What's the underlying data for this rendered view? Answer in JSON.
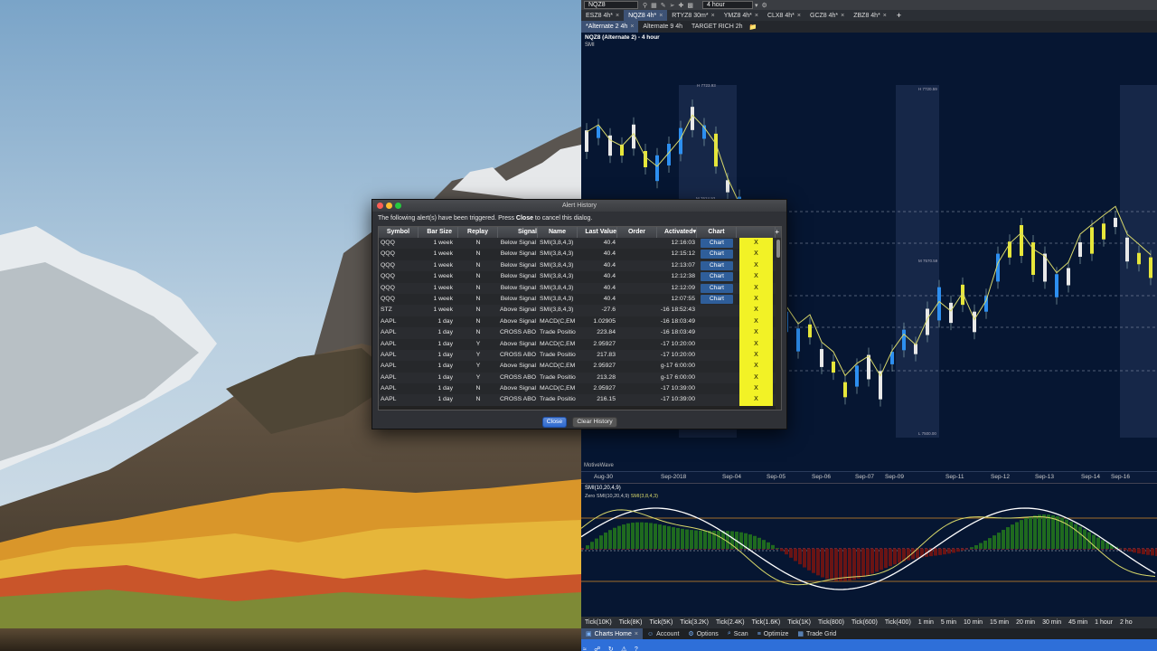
{
  "platform": {
    "symbol_input": "NQZ8",
    "timeframe": "4 hour",
    "symbol_tabs": [
      {
        "label": "ESZ8 4h*"
      },
      {
        "label": "NQZ8 4h*",
        "active": true
      },
      {
        "label": "RTYZ8 30m*"
      },
      {
        "label": "YMZ8 4h*"
      },
      {
        "label": "CLX8 4h*"
      },
      {
        "label": "GCZ8 4h*"
      },
      {
        "label": "ZBZ8 4h*"
      }
    ],
    "workspace_tabs": [
      {
        "label": "*Alternate 2 4h",
        "active": true
      },
      {
        "label": "Alternate 9 4h"
      },
      {
        "label": "TARGET RICH  2h"
      }
    ],
    "chart": {
      "title": "NQZ8 (Alternate 2) - 4 hour",
      "indicator": "SMI",
      "watermark": "MotiveWave",
      "x_labels": [
        "Aug-30",
        "Sep-2018",
        "Sep-04",
        "Sep-05",
        "Sep-06",
        "Sep-07",
        "Sep-09",
        "Sep-11",
        "Sep-12",
        "Sep-13",
        "Sep-14",
        "Sep-16"
      ],
      "level_labels": [
        "H 7723.93",
        "H 7720.59",
        "M 7624.93",
        "M 7570.59",
        "L 7500.00"
      ]
    },
    "smi": {
      "title": "SMI(10,20,4,9)",
      "legend_prefix": "Zero  SMI(10,20,4,9)",
      "legend_series": "SMI(3,8,4,3)"
    },
    "bar_sizes": [
      "Tick(10K)",
      "Tick(8K)",
      "Tick(5K)",
      "Tick(3.2K)",
      "Tick(2.4K)",
      "Tick(1.6K)",
      "Tick(1K)",
      "Tick(800)",
      "Tick(600)",
      "Tick(400)",
      "1 min",
      "5 min",
      "10 min",
      "15 min",
      "20 min",
      "30 min",
      "45 min",
      "1 hour",
      "2 ho"
    ],
    "bottom_tabs": [
      {
        "label": "Charts Home",
        "active": true
      },
      {
        "label": "Account"
      },
      {
        "label": "Options"
      },
      {
        "label": "Scan"
      },
      {
        "label": "Optimize"
      },
      {
        "label": "Trade Grid"
      }
    ],
    "colors": {
      "background": "#061632",
      "bull_candle": "#2d8ff0",
      "bear_candle": "#e8e8e8",
      "yellow_candle": "#e6e63a",
      "ma_line": "#d8d86a",
      "status_bar": "#2e6fd9"
    }
  },
  "dialog": {
    "title": "Alert History",
    "message_pre": "The following alert(s) have been triggered.  Press ",
    "message_bold": "Close",
    "message_post": " to cancel this dialog.",
    "columns": [
      "Symbol",
      "Bar Size",
      "Replay",
      "Signal",
      "Name",
      "Last Value",
      "Order",
      "Activated▾",
      "Chart",
      ""
    ],
    "rows": [
      {
        "symbol": "QQQ",
        "bar_size": "1 week",
        "replay": "N",
        "signal": "Below Signal",
        "name": "SMI(3,8,4,3)",
        "last": "40.4",
        "order": "",
        "activated": "12:16:03",
        "chart": "Chart",
        "x": "X"
      },
      {
        "symbol": "QQQ",
        "bar_size": "1 week",
        "replay": "N",
        "signal": "Below Signal",
        "name": "SMI(3,8,4,3)",
        "last": "40.4",
        "order": "",
        "activated": "12:15:12",
        "chart": "Chart",
        "x": "X"
      },
      {
        "symbol": "QQQ",
        "bar_size": "1 week",
        "replay": "N",
        "signal": "Below Signal",
        "name": "SMI(3,8,4,3)",
        "last": "40.4",
        "order": "",
        "activated": "12:13:07",
        "chart": "Chart",
        "x": "X"
      },
      {
        "symbol": "QQQ",
        "bar_size": "1 week",
        "replay": "N",
        "signal": "Below Signal",
        "name": "SMI(3,8,4,3)",
        "last": "40.4",
        "order": "",
        "activated": "12:12:38",
        "chart": "Chart",
        "x": "X"
      },
      {
        "symbol": "QQQ",
        "bar_size": "1 week",
        "replay": "N",
        "signal": "Below Signal",
        "name": "SMI(3,8,4,3)",
        "last": "40.4",
        "order": "",
        "activated": "12:12:09",
        "chart": "Chart",
        "x": "X"
      },
      {
        "symbol": "QQQ",
        "bar_size": "1 week",
        "replay": "N",
        "signal": "Below Signal",
        "name": "SMI(3,8,4,3)",
        "last": "40.4",
        "order": "",
        "activated": "12:07:55",
        "chart": "Chart",
        "x": "X"
      },
      {
        "symbol": "STZ",
        "bar_size": "1 week",
        "replay": "N",
        "signal": "Above Signal",
        "name": "SMI(3,8,4,3)",
        "last": "-27.6",
        "order": "",
        "activated": "-16 18:52:43",
        "chart": "",
        "x": "X"
      },
      {
        "symbol": "AAPL",
        "bar_size": "1 day",
        "replay": "N",
        "signal": "Above Signal",
        "name": "MACD(C,EM",
        "last": "1.02905",
        "order": "",
        "activated": "-16 18:03:49",
        "chart": "",
        "x": "X"
      },
      {
        "symbol": "AAPL",
        "bar_size": "1 day",
        "replay": "N",
        "signal": "CROSS ABO",
        "name": "Trade Positio",
        "last": "223.84",
        "order": "",
        "activated": "-16 18:03:49",
        "chart": "",
        "x": "X"
      },
      {
        "symbol": "AAPL",
        "bar_size": "1 day",
        "replay": "Y",
        "signal": "Above Signal",
        "name": "MACD(C,EM",
        "last": "2.95927",
        "order": "",
        "activated": "-17 10:20:00",
        "chart": "",
        "x": "X"
      },
      {
        "symbol": "AAPL",
        "bar_size": "1 day",
        "replay": "Y",
        "signal": "CROSS ABO",
        "name": "Trade Positio",
        "last": "217.83",
        "order": "",
        "activated": "-17 10:20:00",
        "chart": "",
        "x": "X"
      },
      {
        "symbol": "AAPL",
        "bar_size": "1 day",
        "replay": "Y",
        "signal": "Above Signal",
        "name": "MACD(C,EM",
        "last": "2.95927",
        "order": "",
        "activated": "g-17 6:00:00",
        "chart": "",
        "x": "X"
      },
      {
        "symbol": "AAPL",
        "bar_size": "1 day",
        "replay": "Y",
        "signal": "CROSS ABO",
        "name": "Trade Positio",
        "last": "213.28",
        "order": "",
        "activated": "g-17 6:00:00",
        "chart": "",
        "x": "X"
      },
      {
        "symbol": "AAPL",
        "bar_size": "1 day",
        "replay": "N",
        "signal": "Above Signal",
        "name": "MACD(C,EM",
        "last": "2.95927",
        "order": "",
        "activated": "-17 10:39:00",
        "chart": "",
        "x": "X"
      },
      {
        "symbol": "AAPL",
        "bar_size": "1 day",
        "replay": "N",
        "signal": "CROSS ABO",
        "name": "Trade Positio",
        "last": "216.15",
        "order": "",
        "activated": "-17 10:39:00",
        "chart": "",
        "x": "X"
      }
    ],
    "close_label": "Close",
    "clear_label": "Clear History"
  }
}
